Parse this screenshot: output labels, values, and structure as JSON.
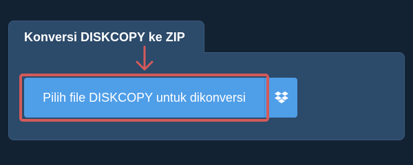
{
  "panel": {
    "title": "Konversi DISKCOPY ke ZIP"
  },
  "upload": {
    "choose_file_label": "Pilih file DISKCOPY untuk dikonversi",
    "dropbox_icon": "dropbox-icon"
  },
  "annotation": {
    "arrow_icon": "arrow-down-icon",
    "highlight_color": "#d45a5a"
  },
  "colors": {
    "background": "#132233",
    "panel": "#2c4a6a",
    "button": "#4f9ee8",
    "accent": "#d45a5a"
  }
}
